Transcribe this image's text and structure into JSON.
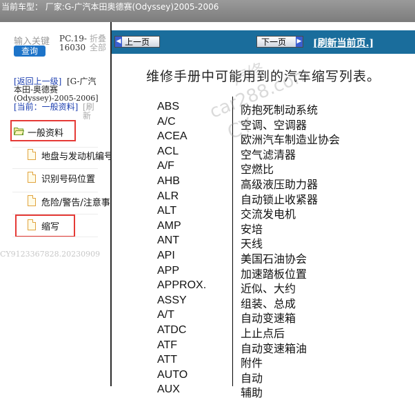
{
  "header": {
    "current_model": "当前车型：  厂家:G-广汽本田奥德赛(Odyssey)2005-2006"
  },
  "sidebar": {
    "search_placeholder": "输入关键",
    "search_button": "查询",
    "code_line1": "PC.19-",
    "code_line2": "16030",
    "fold_line1": "折叠",
    "fold_line2": "全部",
    "back_link": "[返回上一级]",
    "breadcrumb_line1": "[G-广汽",
    "breadcrumb_line2": "本田-奥德赛",
    "breadcrumb_line3": "(Odyssey)-2005-2006]",
    "current_label": "[当前：一般资料]",
    "refresh_short_1": "[刷",
    "refresh_short_2": "新",
    "tree": [
      {
        "label": "一般资料",
        "icon": "folder-open-icon"
      },
      {
        "label": "地盘与发动机编号",
        "icon": "document-icon"
      },
      {
        "label": "识别号码位置",
        "icon": "document-icon"
      },
      {
        "label": "危险/警告/注意事项",
        "icon": "document-icon"
      },
      {
        "label": "缩写",
        "icon": "document-icon"
      }
    ],
    "footer_code": "CY9123367828.20230909"
  },
  "nav": {
    "prev": "上一页",
    "next": "下一页",
    "refresh": "[刷新当前页.]"
  },
  "doc": {
    "title": "维修手册中可能用到的汽车缩写列表。",
    "rows": [
      {
        "code": "ABS",
        "desc": "防抱死制动系统"
      },
      {
        "code": "A/C",
        "desc": "空调、空调器"
      },
      {
        "code": "ACEA",
        "desc": "欧洲汽车制造业协会"
      },
      {
        "code": "ACL",
        "desc": "空气滤清器"
      },
      {
        "code": "A/F",
        "desc": "空燃比"
      },
      {
        "code": "AHB",
        "desc": "高级液压助力器"
      },
      {
        "code": "ALR",
        "desc": "自动锁止收紧器"
      },
      {
        "code": "ALT",
        "desc": "交流发电机"
      },
      {
        "code": "AMP",
        "desc": "安培"
      },
      {
        "code": "ANT",
        "desc": "天线"
      },
      {
        "code": "API",
        "desc": "美国石油协会"
      },
      {
        "code": "APP",
        "desc": "加速踏板位置"
      },
      {
        "code": "APPROX.",
        "desc": "近似、大约"
      },
      {
        "code": "ASSY",
        "desc": "组装、总成"
      },
      {
        "code": "A/T",
        "desc": "自动变速箱"
      },
      {
        "code": "ATDC",
        "desc": "上止点后"
      },
      {
        "code": "ATF",
        "desc": "自动变速箱油"
      },
      {
        "code": "ATT",
        "desc": "附件"
      },
      {
        "code": "AUTO",
        "desc": "自动"
      },
      {
        "code": "AUX",
        "desc": "辅助"
      }
    ]
  },
  "watermark": {
    "line1": "car288.com",
    "line2": "CY",
    "line3": "汽修"
  }
}
